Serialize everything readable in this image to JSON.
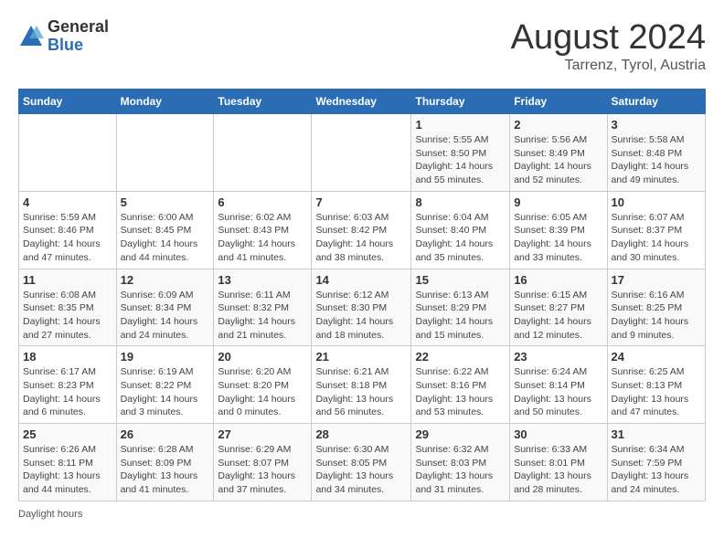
{
  "header": {
    "logo_general": "General",
    "logo_blue": "Blue",
    "month": "August 2024",
    "location": "Tarrenz, Tyrol, Austria"
  },
  "weekdays": [
    "Sunday",
    "Monday",
    "Tuesday",
    "Wednesday",
    "Thursday",
    "Friday",
    "Saturday"
  ],
  "weeks": [
    [
      {
        "day": "",
        "info": ""
      },
      {
        "day": "",
        "info": ""
      },
      {
        "day": "",
        "info": ""
      },
      {
        "day": "",
        "info": ""
      },
      {
        "day": "1",
        "info": "Sunrise: 5:55 AM\nSunset: 8:50 PM\nDaylight: 14 hours\nand 55 minutes."
      },
      {
        "day": "2",
        "info": "Sunrise: 5:56 AM\nSunset: 8:49 PM\nDaylight: 14 hours\nand 52 minutes."
      },
      {
        "day": "3",
        "info": "Sunrise: 5:58 AM\nSunset: 8:48 PM\nDaylight: 14 hours\nand 49 minutes."
      }
    ],
    [
      {
        "day": "4",
        "info": "Sunrise: 5:59 AM\nSunset: 8:46 PM\nDaylight: 14 hours\nand 47 minutes."
      },
      {
        "day": "5",
        "info": "Sunrise: 6:00 AM\nSunset: 8:45 PM\nDaylight: 14 hours\nand 44 minutes."
      },
      {
        "day": "6",
        "info": "Sunrise: 6:02 AM\nSunset: 8:43 PM\nDaylight: 14 hours\nand 41 minutes."
      },
      {
        "day": "7",
        "info": "Sunrise: 6:03 AM\nSunset: 8:42 PM\nDaylight: 14 hours\nand 38 minutes."
      },
      {
        "day": "8",
        "info": "Sunrise: 6:04 AM\nSunset: 8:40 PM\nDaylight: 14 hours\nand 35 minutes."
      },
      {
        "day": "9",
        "info": "Sunrise: 6:05 AM\nSunset: 8:39 PM\nDaylight: 14 hours\nand 33 minutes."
      },
      {
        "day": "10",
        "info": "Sunrise: 6:07 AM\nSunset: 8:37 PM\nDaylight: 14 hours\nand 30 minutes."
      }
    ],
    [
      {
        "day": "11",
        "info": "Sunrise: 6:08 AM\nSunset: 8:35 PM\nDaylight: 14 hours\nand 27 minutes."
      },
      {
        "day": "12",
        "info": "Sunrise: 6:09 AM\nSunset: 8:34 PM\nDaylight: 14 hours\nand 24 minutes."
      },
      {
        "day": "13",
        "info": "Sunrise: 6:11 AM\nSunset: 8:32 PM\nDaylight: 14 hours\nand 21 minutes."
      },
      {
        "day": "14",
        "info": "Sunrise: 6:12 AM\nSunset: 8:30 PM\nDaylight: 14 hours\nand 18 minutes."
      },
      {
        "day": "15",
        "info": "Sunrise: 6:13 AM\nSunset: 8:29 PM\nDaylight: 14 hours\nand 15 minutes."
      },
      {
        "day": "16",
        "info": "Sunrise: 6:15 AM\nSunset: 8:27 PM\nDaylight: 14 hours\nand 12 minutes."
      },
      {
        "day": "17",
        "info": "Sunrise: 6:16 AM\nSunset: 8:25 PM\nDaylight: 14 hours\nand 9 minutes."
      }
    ],
    [
      {
        "day": "18",
        "info": "Sunrise: 6:17 AM\nSunset: 8:23 PM\nDaylight: 14 hours\nand 6 minutes."
      },
      {
        "day": "19",
        "info": "Sunrise: 6:19 AM\nSunset: 8:22 PM\nDaylight: 14 hours\nand 3 minutes."
      },
      {
        "day": "20",
        "info": "Sunrise: 6:20 AM\nSunset: 8:20 PM\nDaylight: 14 hours\nand 0 minutes."
      },
      {
        "day": "21",
        "info": "Sunrise: 6:21 AM\nSunset: 8:18 PM\nDaylight: 13 hours\nand 56 minutes."
      },
      {
        "day": "22",
        "info": "Sunrise: 6:22 AM\nSunset: 8:16 PM\nDaylight: 13 hours\nand 53 minutes."
      },
      {
        "day": "23",
        "info": "Sunrise: 6:24 AM\nSunset: 8:14 PM\nDaylight: 13 hours\nand 50 minutes."
      },
      {
        "day": "24",
        "info": "Sunrise: 6:25 AM\nSunset: 8:13 PM\nDaylight: 13 hours\nand 47 minutes."
      }
    ],
    [
      {
        "day": "25",
        "info": "Sunrise: 6:26 AM\nSunset: 8:11 PM\nDaylight: 13 hours\nand 44 minutes."
      },
      {
        "day": "26",
        "info": "Sunrise: 6:28 AM\nSunset: 8:09 PM\nDaylight: 13 hours\nand 41 minutes."
      },
      {
        "day": "27",
        "info": "Sunrise: 6:29 AM\nSunset: 8:07 PM\nDaylight: 13 hours\nand 37 minutes."
      },
      {
        "day": "28",
        "info": "Sunrise: 6:30 AM\nSunset: 8:05 PM\nDaylight: 13 hours\nand 34 minutes."
      },
      {
        "day": "29",
        "info": "Sunrise: 6:32 AM\nSunset: 8:03 PM\nDaylight: 13 hours\nand 31 minutes."
      },
      {
        "day": "30",
        "info": "Sunrise: 6:33 AM\nSunset: 8:01 PM\nDaylight: 13 hours\nand 28 minutes."
      },
      {
        "day": "31",
        "info": "Sunrise: 6:34 AM\nSunset: 7:59 PM\nDaylight: 13 hours\nand 24 minutes."
      }
    ]
  ],
  "footer": {
    "daylight_note": "Daylight hours"
  }
}
